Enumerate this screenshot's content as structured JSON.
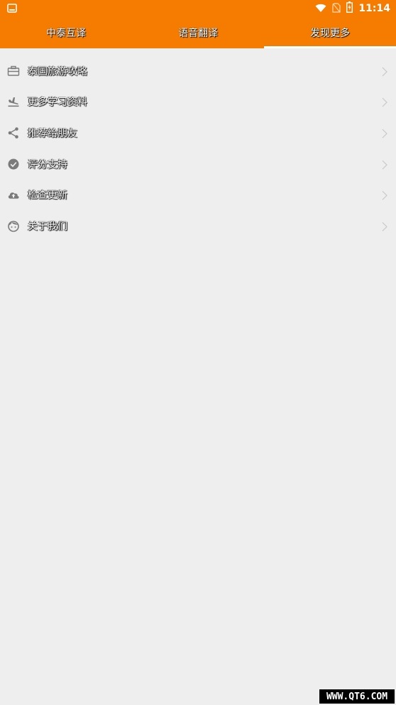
{
  "status_bar": {
    "time": "11:14",
    "icons": [
      "screen-cast-icon",
      "wifi-icon",
      "no-sim-icon",
      "battery-charging-icon"
    ]
  },
  "tabs": [
    {
      "label": "中泰互译"
    },
    {
      "label": "语音翻译"
    },
    {
      "label": "发现更多"
    }
  ],
  "active_tab": 2,
  "menu": [
    {
      "label": "泰国旅游攻略",
      "icon": "briefcase-icon"
    },
    {
      "label": "更多学习资料",
      "icon": "plane-landing-icon"
    },
    {
      "label": "推荐给朋友",
      "icon": "share-icon"
    },
    {
      "label": "评分支持",
      "icon": "check-circle-icon"
    },
    {
      "label": "检查更新",
      "icon": "cloud-upload-icon"
    },
    {
      "label": "关于我们",
      "icon": "face-icon"
    }
  ],
  "colors": {
    "accent": "#f57c00",
    "background": "#eeeeee",
    "icon": "#7a7a7a"
  },
  "watermark": "WWW.QT6.COM"
}
